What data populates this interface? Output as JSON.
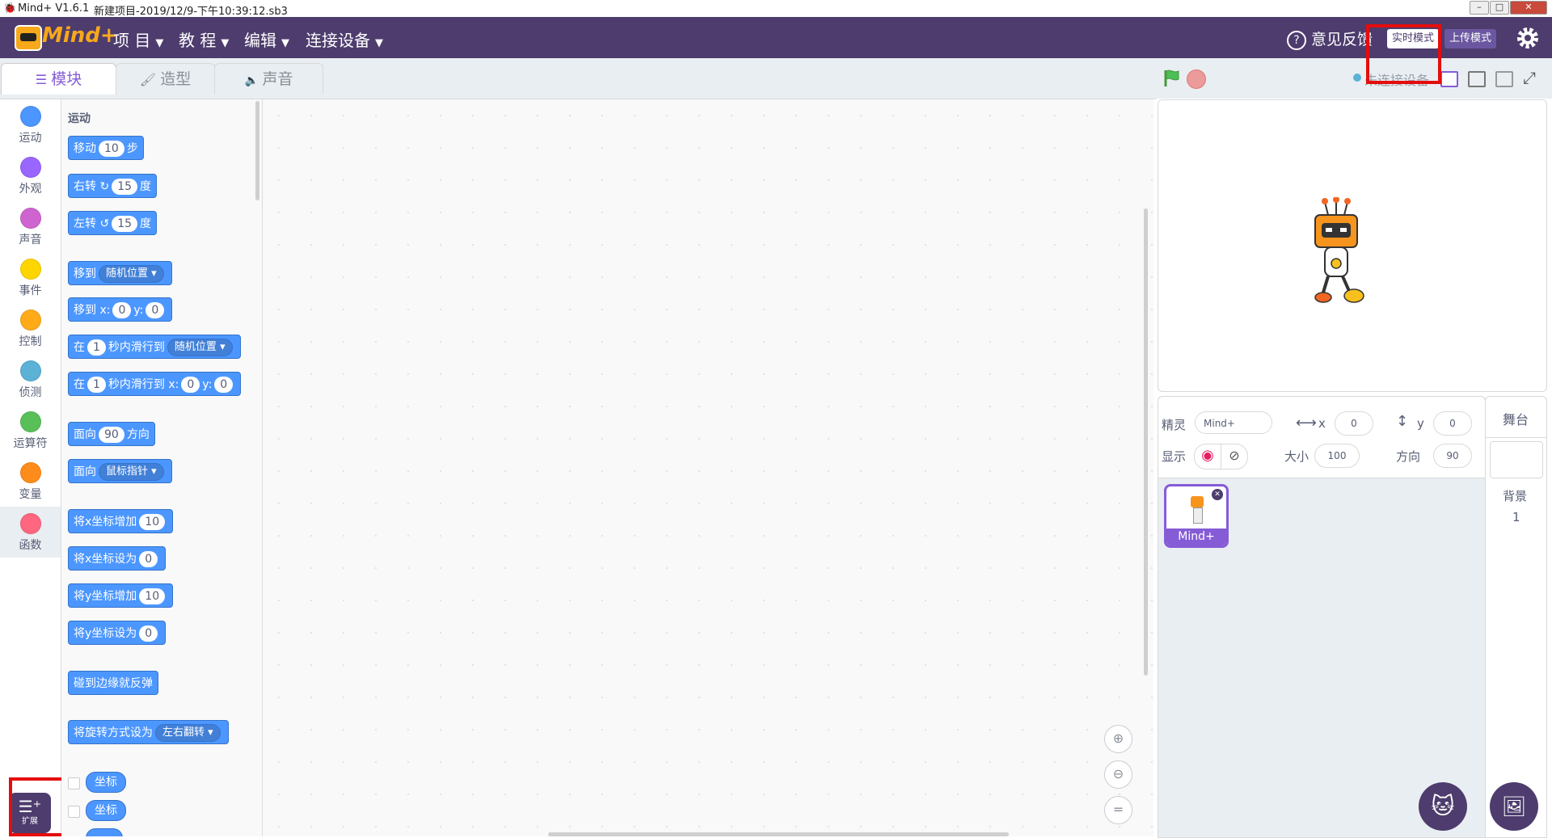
{
  "titlebar": {
    "app": "Mind+ V1.6.1",
    "file": "新建项目-2019/12/9-下午10:39:12.sb3"
  },
  "menubar": {
    "logo_text": "Mind+",
    "items": [
      "项 目",
      "教 程",
      "编辑",
      "连接设备"
    ],
    "feedback": "意见反馈",
    "realtime_mode": "实时模式",
    "upload_mode": "上传模式"
  },
  "tabs": [
    "模块",
    "造型",
    "声音"
  ],
  "categories": [
    {
      "label": "运动",
      "color": "#4c97ff"
    },
    {
      "label": "外观",
      "color": "#9966ff"
    },
    {
      "label": "声音",
      "color": "#cf63cf"
    },
    {
      "label": "事件",
      "color": "#ffd500"
    },
    {
      "label": "控制",
      "color": "#ffab19"
    },
    {
      "label": "侦测",
      "color": "#5cb1d6"
    },
    {
      "label": "运算符",
      "color": "#59c059"
    },
    {
      "label": "变量",
      "color": "#ff8c1a"
    },
    {
      "label": "函数",
      "color": "#ff6680"
    }
  ],
  "extension_label": "扩展",
  "palette": {
    "section_title": "运动",
    "b1": {
      "a": "移动",
      "v": "10",
      "b": "步"
    },
    "b2": {
      "a": "右转",
      "v": "15",
      "b": "度"
    },
    "b3": {
      "a": "左转",
      "v": "15",
      "b": "度"
    },
    "b4": {
      "a": "移到",
      "dd": "随机位置"
    },
    "b5": {
      "a": "移到 x:",
      "x": "0",
      "y_label": "y:",
      "y": "0"
    },
    "b6": {
      "a": "在",
      "v": "1",
      "b": "秒内滑行到",
      "dd": "随机位置"
    },
    "b7": {
      "a": "在",
      "v": "1",
      "b": "秒内滑行到 x:",
      "x": "0",
      "y_label": "y:",
      "y": "0"
    },
    "b8": {
      "a": "面向",
      "v": "90",
      "b": "方向"
    },
    "b9": {
      "a": "面向",
      "dd": "鼠标指针"
    },
    "b10": {
      "a": "将x坐标增加",
      "v": "10"
    },
    "b11": {
      "a": "将x坐标设为",
      "v": "0"
    },
    "b12": {
      "a": "将y坐标增加",
      "v": "10"
    },
    "b13": {
      "a": "将y坐标设为",
      "v": "0"
    },
    "b14": {
      "a": "碰到边缘就反弹"
    },
    "b15": {
      "a": "将旋转方式设为",
      "dd": "左右翻转"
    },
    "r1": "坐标",
    "r2": "坐标"
  },
  "stage_header": {
    "status": "未连接设备"
  },
  "sprite_info": {
    "sprite_label": "精灵",
    "sprite_name": "Mind+",
    "x_label": "x",
    "x": "0",
    "y_label": "y",
    "y": "0",
    "show_label": "显示",
    "size_label": "大小",
    "size": "100",
    "dir_label": "方向",
    "dir": "90"
  },
  "sprites": [
    {
      "name": "Mind+"
    }
  ],
  "stage_pane": {
    "title": "舞台",
    "backdrop_label": "背景",
    "backdrop_count": "1"
  },
  "colors": {
    "menubar": "#4d3c6d",
    "motion": "#4c97ff",
    "accent": "#855cd6",
    "highlight": "#e40d0d"
  }
}
